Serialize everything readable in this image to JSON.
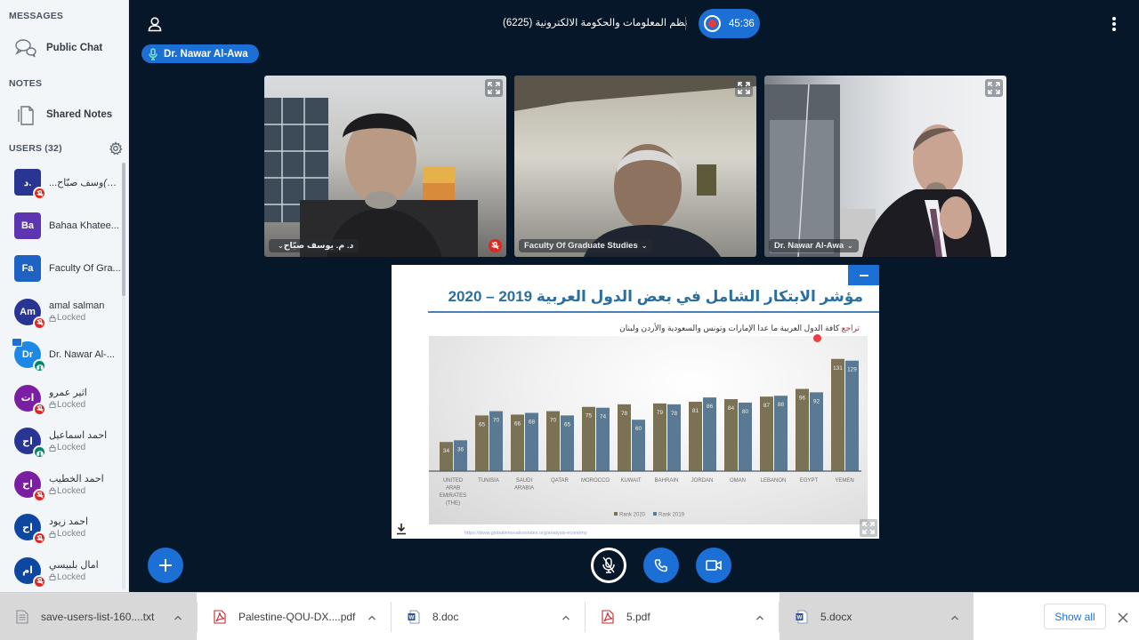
{
  "sidebar": {
    "messages_title": "MESSAGES",
    "public_chat": "Public Chat",
    "notes_title": "NOTES",
    "shared_notes": "Shared Notes",
    "users_title": "USERS (32)",
    "users": [
      {
        "initials": "د.",
        "name": "...وسف صبّاح",
        "suffix": "(You)",
        "status": "",
        "color": "#283593",
        "shape": "square",
        "badge": "muted"
      },
      {
        "initials": "Ba",
        "name": "Bahaa Khatee...",
        "suffix": "",
        "status": "",
        "color": "#5e35b1",
        "shape": "square",
        "badge": ""
      },
      {
        "initials": "Fa",
        "name": "Faculty Of Gra...",
        "suffix": "",
        "status": "",
        "color": "#1e63c4",
        "shape": "square",
        "badge": ""
      },
      {
        "initials": "Am",
        "name": "amal salman",
        "suffix": "",
        "status": "Locked",
        "color": "#283593",
        "shape": "circle",
        "badge": "muted"
      },
      {
        "initials": "Dr",
        "name": "Dr. Nawar Al-...",
        "suffix": "",
        "status": "",
        "color": "#1e88e5",
        "shape": "circle",
        "badge": "listen",
        "presenter": true
      },
      {
        "initials": "ات",
        "name": "اثير عمرو",
        "suffix": "",
        "status": "Locked",
        "color": "#7b1fa2",
        "shape": "circle",
        "badge": "muted"
      },
      {
        "initials": "اح",
        "name": "احمد اسماعيل",
        "suffix": "",
        "status": "Locked",
        "color": "#283593",
        "shape": "circle",
        "badge": "listen"
      },
      {
        "initials": "اح",
        "name": "احمد الخطيب",
        "suffix": "",
        "status": "Locked",
        "color": "#7b1fa2",
        "shape": "circle",
        "badge": "muted"
      },
      {
        "initials": "اح",
        "name": "احمد زيود",
        "suffix": "",
        "status": "Locked",
        "color": "#0d47a1",
        "shape": "circle",
        "badge": "muted"
      },
      {
        "initials": "ام",
        "name": "امال بلبيسي",
        "suffix": "",
        "status": "Locked",
        "color": "#0d47a1",
        "shape": "circle",
        "badge": "muted"
      }
    ]
  },
  "topbar": {
    "meeting_title": "نظم المعلومات والحكومة الالكترونية (6225)",
    "recording_time": "45:36",
    "talking_indicator": "Dr. Nawar Al-Awa"
  },
  "videos": [
    {
      "name": "د. م. يوسف صبّاح",
      "muted": true
    },
    {
      "name": "Faculty Of Graduate Studies",
      "muted": false
    },
    {
      "name": "Dr. Nawar Al-Awa",
      "muted": false
    }
  ],
  "presentation": {
    "title": "مؤشر الابتكار الشامل في بعض الدول العربية 2019 – 2020",
    "subtitle_highlight": "تراجع",
    "subtitle_rest": " كافة الدول العربية ما عدا الإمارات وتونس والسعودية والأردن ولبنان",
    "source_url": "https://www.globalinnovationindex.org/analysis-economy"
  },
  "chart_data": {
    "type": "bar",
    "title": "مؤشر الابتكار الشامل في بعض الدول العربية 2019 – 2020",
    "categories": [
      "UNITED ARAB EMIRATES (THE)",
      "TUNISIA",
      "SAUDI ARABIA",
      "QATAR",
      "MOROCCO",
      "KUWAIT",
      "BAHRAIN",
      "JORDAN",
      "OMAN",
      "LEBANON",
      "EGYPT",
      "YEMEN"
    ],
    "category_lines": [
      [
        "UNITED",
        "ARAB",
        "EMIRATES",
        "(THE)"
      ],
      [
        "TUNISIA"
      ],
      [
        "SAUDI",
        "ARABIA"
      ],
      [
        "QATAR"
      ],
      [
        "MOROCCO"
      ],
      [
        "KUWAIT"
      ],
      [
        "BAHRAIN"
      ],
      [
        "JORDAN"
      ],
      [
        "OMAN"
      ],
      [
        "LEBANON"
      ],
      [
        "EGYPT"
      ],
      [
        "YEMEN"
      ]
    ],
    "series": [
      {
        "name": "Rank 2020",
        "color": "#7b7255",
        "values": [
          34,
          65,
          66,
          70,
          75,
          78,
          79,
          81,
          84,
          87,
          96,
          131
        ]
      },
      {
        "name": "Rank 2019",
        "color": "#5a7a94",
        "values": [
          36,
          70,
          68,
          65,
          74,
          60,
          78,
          86,
          80,
          88,
          92,
          129
        ]
      }
    ],
    "xlabel": "",
    "ylabel": "",
    "ylim": [
      0,
      140
    ],
    "grid": false,
    "legend": "bottom-right"
  },
  "downloads": [
    {
      "name": "save-users-list-160....txt",
      "type": "txt",
      "active": true
    },
    {
      "name": "Palestine-QOU-DX....pdf",
      "type": "pdf",
      "active": false
    },
    {
      "name": "8.doc",
      "type": "doc",
      "active": false
    },
    {
      "name": "5.pdf",
      "type": "pdf",
      "active": false
    },
    {
      "name": "5.docx",
      "type": "doc",
      "active": true
    }
  ],
  "download_bar": {
    "show_all": "Show all"
  },
  "colors": {
    "accent": "#1b6fd5",
    "muted": "#df2721",
    "listen": "#00856a",
    "background": "#06172a"
  }
}
